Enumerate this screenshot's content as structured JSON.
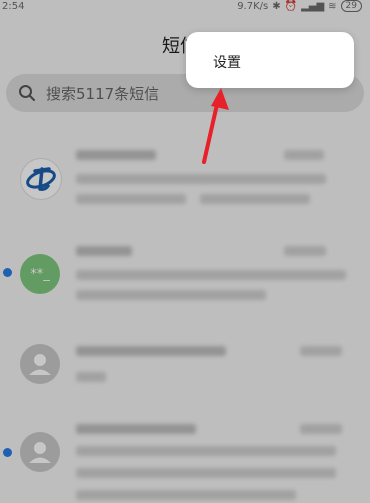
{
  "status_bar": {
    "time": "2:54",
    "network_speed": "9.7K/s",
    "battery": "29"
  },
  "header": {
    "title": "短信"
  },
  "search": {
    "placeholder": "搜索5117条短信"
  },
  "menu": {
    "items": [
      "设置"
    ]
  },
  "conversations": [
    {
      "avatar": "telecom-logo",
      "avatar_text": "",
      "unread": false
    },
    {
      "avatar": "green-initials",
      "avatar_text": "**_",
      "unread": true
    },
    {
      "avatar": "default-person",
      "avatar_text": "",
      "unread": false
    },
    {
      "avatar": "default-person",
      "avatar_text": "",
      "unread": true
    }
  ],
  "colors": {
    "unread_dot": "#2a7be4",
    "overlay": "rgba(0,0,0,0.22)",
    "arrow": "#e8202a"
  }
}
